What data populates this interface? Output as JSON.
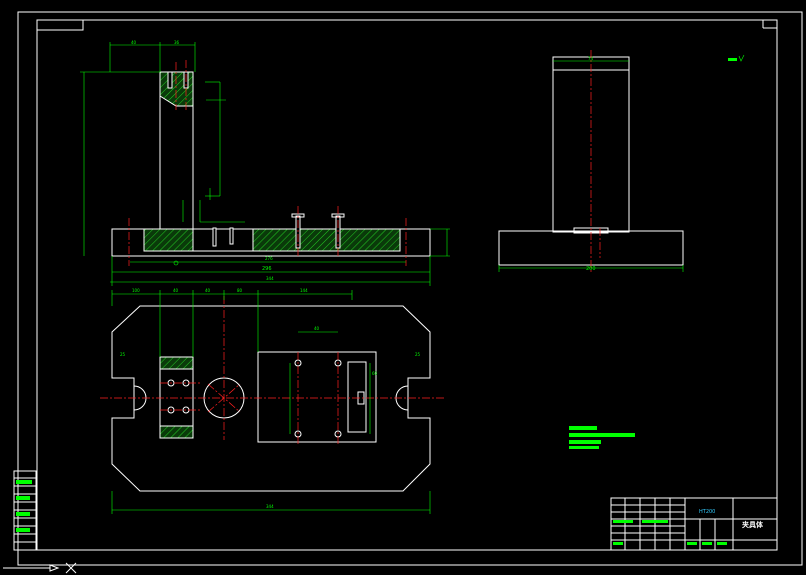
{
  "drawing": {
    "front_view": {
      "dimensions_top": [
        "40",
        "36"
      ],
      "dimensions_bottom": [
        "276",
        "296",
        "344"
      ]
    },
    "side_view": {
      "dimension_top": "74",
      "dimension_bottom": "200"
    },
    "plan_view": {
      "dimensions_top": [
        "100",
        "40",
        "40",
        "80",
        "144"
      ],
      "dimension_bottom": "344",
      "slot_left_label": "25",
      "slot_right_label": "25",
      "inner_dims": [
        "40",
        "60"
      ]
    },
    "title_block": {
      "material": "HT200",
      "title": "夹具体"
    }
  },
  "colors": {
    "background": "#000000",
    "outline": "#ffffff",
    "dimension": "#00ff00",
    "centerline": "#ff2020"
  }
}
